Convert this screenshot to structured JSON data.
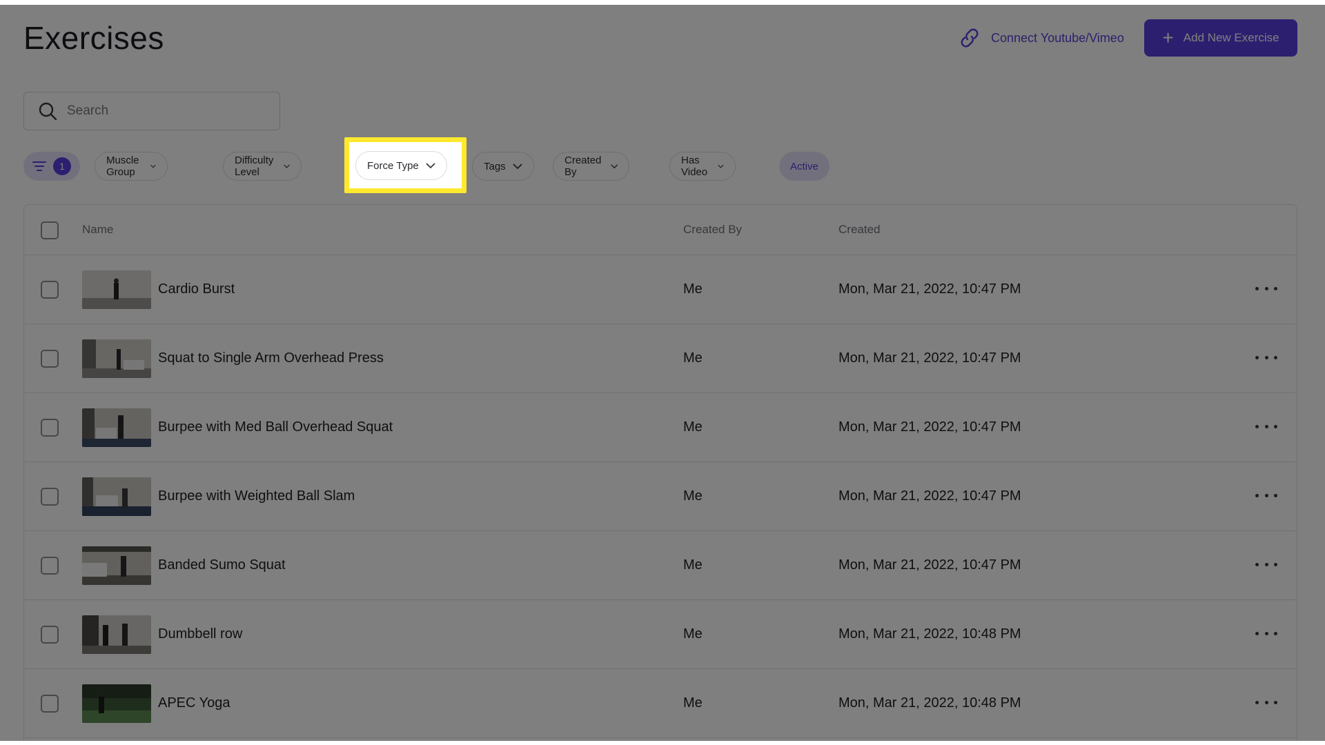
{
  "header": {
    "title": "Exercises",
    "connect_label": "Connect Youtube/Vimeo",
    "add_label": "Add New Exercise"
  },
  "search": {
    "placeholder": "Search"
  },
  "filters": {
    "active_count": "1",
    "muscle_group": "Muscle Group",
    "difficulty": "Difficulty Level",
    "force_type": "Force Type",
    "tags": "Tags",
    "created_by": "Created By",
    "has_video": "Has Video",
    "status": "Active"
  },
  "table": {
    "columns": {
      "name": "Name",
      "created_by": "Created By",
      "created": "Created"
    },
    "rows": [
      {
        "name": "Cardio Burst",
        "created_by": "Me",
        "created": "Mon, Mar 21, 2022, 10:47 PM"
      },
      {
        "name": "Squat to Single Arm Overhead Press",
        "created_by": "Me",
        "created": "Mon, Mar 21, 2022, 10:47 PM"
      },
      {
        "name": "Burpee with Med Ball Overhead Squat",
        "created_by": "Me",
        "created": "Mon, Mar 21, 2022, 10:47 PM"
      },
      {
        "name": "Burpee with Weighted Ball Slam",
        "created_by": "Me",
        "created": "Mon, Mar 21, 2022, 10:47 PM"
      },
      {
        "name": "Banded Sumo Squat",
        "created_by": "Me",
        "created": "Mon, Mar 21, 2022, 10:47 PM"
      },
      {
        "name": "Dumbbell row",
        "created_by": "Me",
        "created": "Mon, Mar 21, 2022, 10:48 PM"
      },
      {
        "name": "APEC Yoga",
        "created_by": "Me",
        "created": "Mon, Mar 21, 2022, 10:48 PM"
      }
    ]
  },
  "colors": {
    "accent": "#5b3fe0",
    "accent_soft": "#e6e1fb",
    "highlight": "#ffe92f"
  }
}
